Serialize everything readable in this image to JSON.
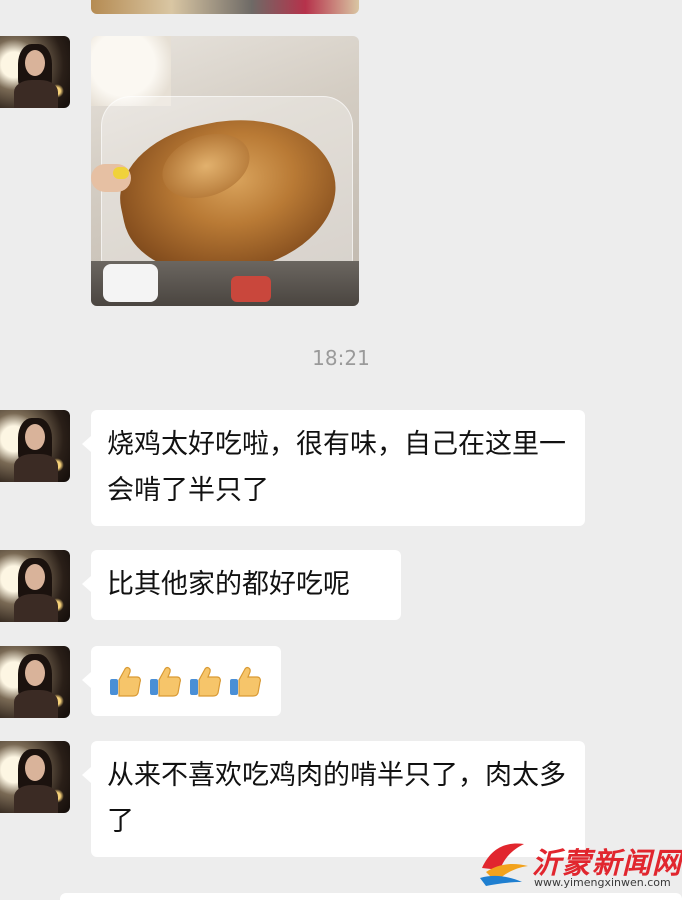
{
  "chat": {
    "timestamp": "18:21",
    "messages": [
      {
        "text": "烧鸡太好吃啦，很有味，自己在这里一会啃了半只了"
      },
      {
        "text": "比其他家的都好吃呢"
      },
      {
        "emoji": [
          "thumbs-up",
          "thumbs-up",
          "thumbs-up",
          "thumbs-up"
        ]
      },
      {
        "text": "从来不喜欢吃鸡肉的啃半只了，肉太多了"
      }
    ]
  },
  "watermark": {
    "title": "沂蒙新闻网",
    "url": "www.yimengxinwen.com"
  }
}
